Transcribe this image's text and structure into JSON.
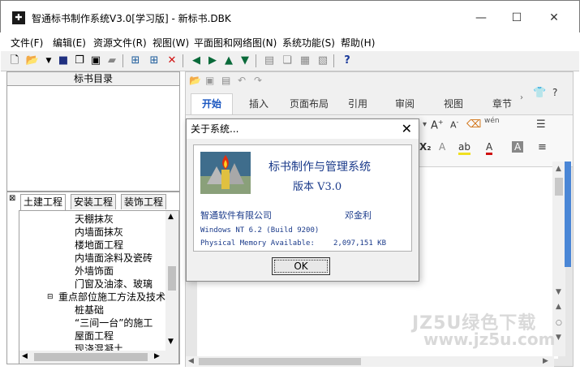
{
  "window": {
    "title": "智通标书制作系统V3.0[学习版] - 新标书.DBK",
    "min": "—",
    "max": "☐",
    "close": "✕"
  },
  "menu": [
    "文件(F)",
    "编辑(E)",
    "资源文件(R)",
    "视图(W)",
    "平面图和网络图(N)",
    "系统功能(S)",
    "帮助(H)"
  ],
  "left_panel": {
    "header": "标书目录",
    "tabs": [
      "土建工程",
      "安装工程",
      "装饰工程"
    ],
    "tree": [
      "天棚抹灰",
      "内墙面抹灰",
      "楼地面工程",
      "内墙面涂料及瓷砖",
      "外墙饰面",
      "门窗及油漆、玻璃",
      "重点部位施工方法及技术",
      "桩基础",
      "“三间一台”的施工",
      "屋面工程",
      "现浇混凝土"
    ]
  },
  "ribbon": {
    "tabs": [
      "开始",
      "插入",
      "页面布局",
      "引用",
      "审阅",
      "视图",
      "章节"
    ]
  },
  "dialog": {
    "title": "关于系统...",
    "product": "标书制作与管理系统",
    "version": "版本 V3.0",
    "company": "智通软件有限公司",
    "author": "邓金利",
    "os": "Windows NT 6.2 (Build 9200)",
    "memory_label": "Physical Memory Available:",
    "memory_value": "2,097,151 KB",
    "ok": "OK"
  },
  "watermark": {
    "line1": "JZ5U绿色下载",
    "line2": "www.jz5u.com"
  }
}
